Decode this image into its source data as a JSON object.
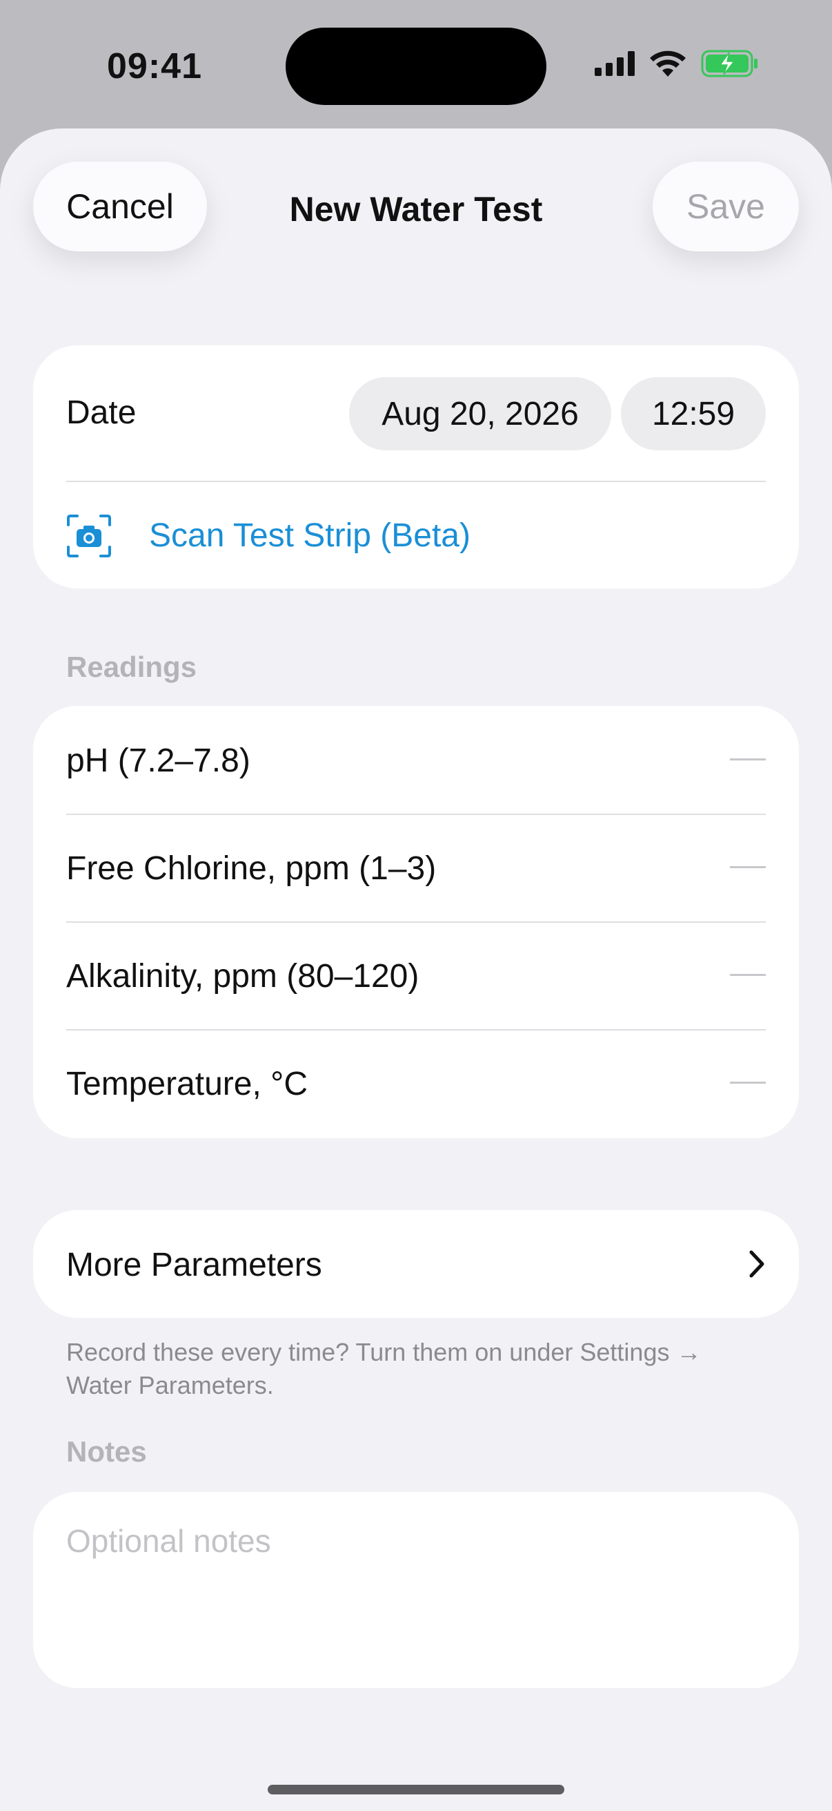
{
  "status_bar": {
    "time": "09:41"
  },
  "nav": {
    "cancel_label": "Cancel",
    "title": "New Water Test",
    "save_label": "Save"
  },
  "date_card": {
    "date_label": "Date",
    "date_value": "Aug 20, 2026",
    "time_value": "12:59",
    "scan_label": "Scan Test Strip (Beta)",
    "scan_icon": "camera-icon"
  },
  "readings": {
    "header": "Readings",
    "items": [
      {
        "label": "pH (7.2–7.8)",
        "value": "—"
      },
      {
        "label": "Free Chlorine, ppm (1–3)",
        "value": "—"
      },
      {
        "label": "Alkalinity, ppm (80–120)",
        "value": "—"
      },
      {
        "label": "Temperature, °C",
        "value": "—"
      }
    ]
  },
  "more_parameters": {
    "label": "More Parameters",
    "icon": "chevron-right-icon",
    "footnote": "Record these every time? Turn them on under Settings → Water Parameters."
  },
  "notes": {
    "header": "Notes",
    "placeholder": "Optional notes"
  },
  "colors": {
    "accent": "#1a8fd6",
    "battery_green": "#34c759",
    "sheet_background": "#f2f2f6"
  }
}
